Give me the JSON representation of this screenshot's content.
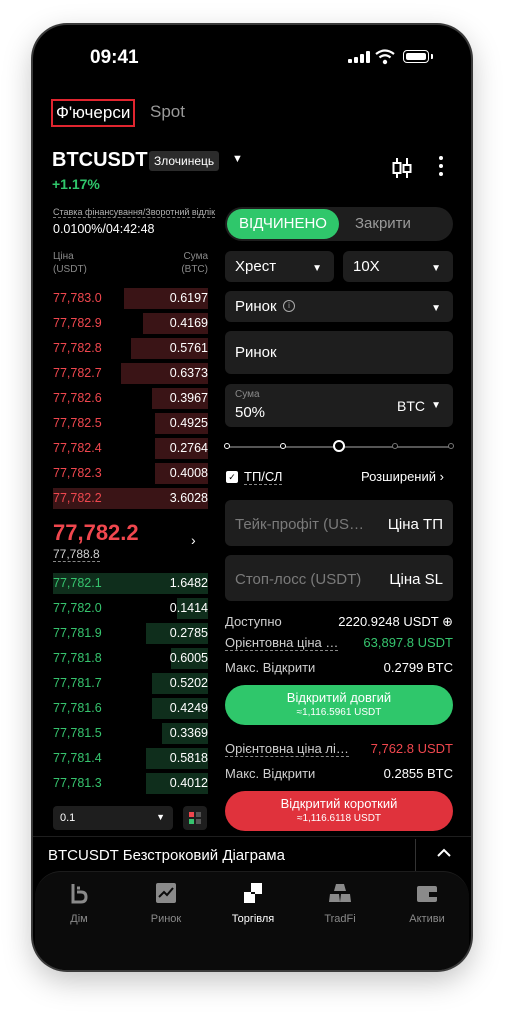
{
  "status_bar": {
    "time": "09:41"
  },
  "top_tabs": {
    "futures": "Ф'ючерси",
    "spot": "Spot"
  },
  "pair": {
    "symbol": "BTCUSDT",
    "badge": "Злочинець",
    "change": "+1.17%"
  },
  "funding": {
    "label": "Ставка фінансування/Зворотний відлік",
    "value": "0.0100%/04:42:48"
  },
  "orderbook": {
    "price_header": "Ціна\n(USDT)",
    "amount_header": "Сума\n(BTC)",
    "asks": [
      {
        "price": "77,783.0",
        "qty": "0.6197",
        "depth": 0.54
      },
      {
        "price": "77,782.9",
        "qty": "0.4169",
        "depth": 0.42
      },
      {
        "price": "77,782.8",
        "qty": "0.5761",
        "depth": 0.5
      },
      {
        "price": "77,782.7",
        "qty": "0.6373",
        "depth": 0.56
      },
      {
        "price": "77,782.6",
        "qty": "0.3967",
        "depth": 0.36
      },
      {
        "price": "77,782.5",
        "qty": "0.4925",
        "depth": 0.34
      },
      {
        "price": "77,782.4",
        "qty": "0.2764",
        "depth": 0.34
      },
      {
        "price": "77,782.3",
        "qty": "0.4008",
        "depth": 0.34
      },
      {
        "price": "77,782.2",
        "qty": "3.6028",
        "depth": 1.0
      }
    ],
    "last_price": "77,782.2",
    "mark_price": "77,788.8",
    "bids": [
      {
        "price": "77,782.1",
        "qty": "1.6482",
        "depth": 1.0
      },
      {
        "price": "77,782.0",
        "qty": "0.1414",
        "depth": 0.2
      },
      {
        "price": "77,781.9",
        "qty": "0.2785",
        "depth": 0.4
      },
      {
        "price": "77,781.8",
        "qty": "0.6005",
        "depth": 0.24
      },
      {
        "price": "77,781.7",
        "qty": "0.5202",
        "depth": 0.36
      },
      {
        "price": "77,781.6",
        "qty": "0.4249",
        "depth": 0.36
      },
      {
        "price": "77,781.5",
        "qty": "0.3369",
        "depth": 0.3
      },
      {
        "price": "77,781.4",
        "qty": "0.5818",
        "depth": 0.4
      },
      {
        "price": "77,781.3",
        "qty": "0.4012",
        "depth": 0.4
      }
    ],
    "precision": "0.1"
  },
  "order_form": {
    "open_label": "ВІДЧИНЕНО",
    "close_label": "Закрити",
    "margin_mode": "Хрест",
    "leverage": "10X",
    "order_type": "Ринок",
    "price_field": "Ринок",
    "amount_label": "Сума",
    "amount_value": "50%",
    "amount_unit": "BTC",
    "slider_percent": 50,
    "tpsl_label": "ТП/СЛ",
    "advanced_label": "Розширений",
    "tp_placeholder": "Тейк-профіт (USDT)",
    "tp_unit": "Ціна ТП",
    "sl_placeholder": "Стоп-лосс (USDT)",
    "sl_unit": "Ціна SL"
  },
  "info": {
    "available_label": "Доступно",
    "available_value": "2220.9248 USDT",
    "est_price_label": "Орієнтовна ціна …",
    "est_price_value": "63,897.8 USDT",
    "max_open_label": "Макс. Відкрити",
    "max_open_long": "0.2799 BTC",
    "est_liq_label": "Орієнтовна ціна лі…",
    "est_liq_value": "7,762.8 USDT",
    "max_open_short": "0.2855 BTC"
  },
  "buttons": {
    "long_label": "Відкритий довгий",
    "long_sub": "≈1,116.5961 USDT",
    "short_label": "Відкритий короткий",
    "short_sub": "≈1,116.6118 USDT"
  },
  "chart_bar": {
    "title": "BTCUSDT Безстроковий Діаграма"
  },
  "bottom_nav": [
    "Дім",
    "Ринок",
    "Торгівля",
    "TradFi",
    "Активи"
  ],
  "colors": {
    "green": "#2fc76b",
    "red": "#e0323c",
    "background": "#000000"
  }
}
